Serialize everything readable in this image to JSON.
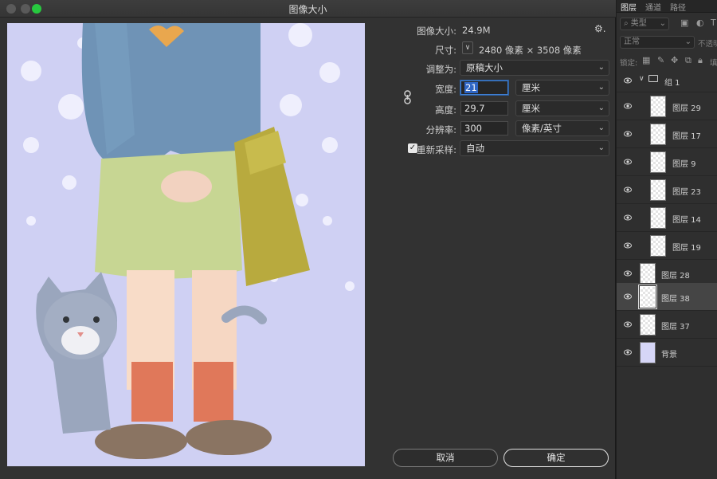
{
  "window": {
    "title": "图像大小"
  },
  "image_size": {
    "label": "图像大小:",
    "value": "24.9M",
    "gear_glyph": "⚙.",
    "dimensions_label": "尺寸:",
    "dimensions_value": "2480 像素  ×  3508 像素",
    "fit_label": "调整为:",
    "fit_value": "原稿大小",
    "width_label": "宽度:",
    "width_value": "21",
    "width_unit": "厘米",
    "height_label": "高度:",
    "height_value": "29.7",
    "height_unit": "厘米",
    "resolution_label": "分辨率:",
    "resolution_value": "300",
    "resolution_unit": "像素/英寸",
    "resample_label": "重新采样:",
    "resample_value": "自动",
    "resample_checked": true
  },
  "buttons": {
    "cancel": "取消",
    "ok": "确定"
  },
  "panel": {
    "tabs": [
      "图层",
      "通道",
      "路径"
    ],
    "filter_placeholder": "类型",
    "blend_mode": "正常",
    "opacity_label": "不透明",
    "lock_label": "锁定:",
    "fill_label": "填",
    "group_name": "组 1",
    "layers": [
      {
        "name": "图层 29",
        "indent": true,
        "selected": false
      },
      {
        "name": "图层 17",
        "indent": true,
        "selected": false
      },
      {
        "name": "图层 9",
        "indent": true,
        "selected": false
      },
      {
        "name": "图层 23",
        "indent": true,
        "selected": false
      },
      {
        "name": "图层 14",
        "indent": true,
        "selected": false
      },
      {
        "name": "图层 19",
        "indent": true,
        "selected": false
      },
      {
        "name": "图层 28",
        "indent": false,
        "selected": false
      },
      {
        "name": "图层 38",
        "indent": false,
        "selected": true
      },
      {
        "name": "图层 37",
        "indent": false,
        "selected": false
      },
      {
        "name": "背景",
        "indent": false,
        "selected": false,
        "background": true
      }
    ]
  },
  "colors": {
    "accent_blue": "#2f66c5",
    "maximize_green": "#27c93f",
    "preview_background": "#cfd0f3"
  }
}
